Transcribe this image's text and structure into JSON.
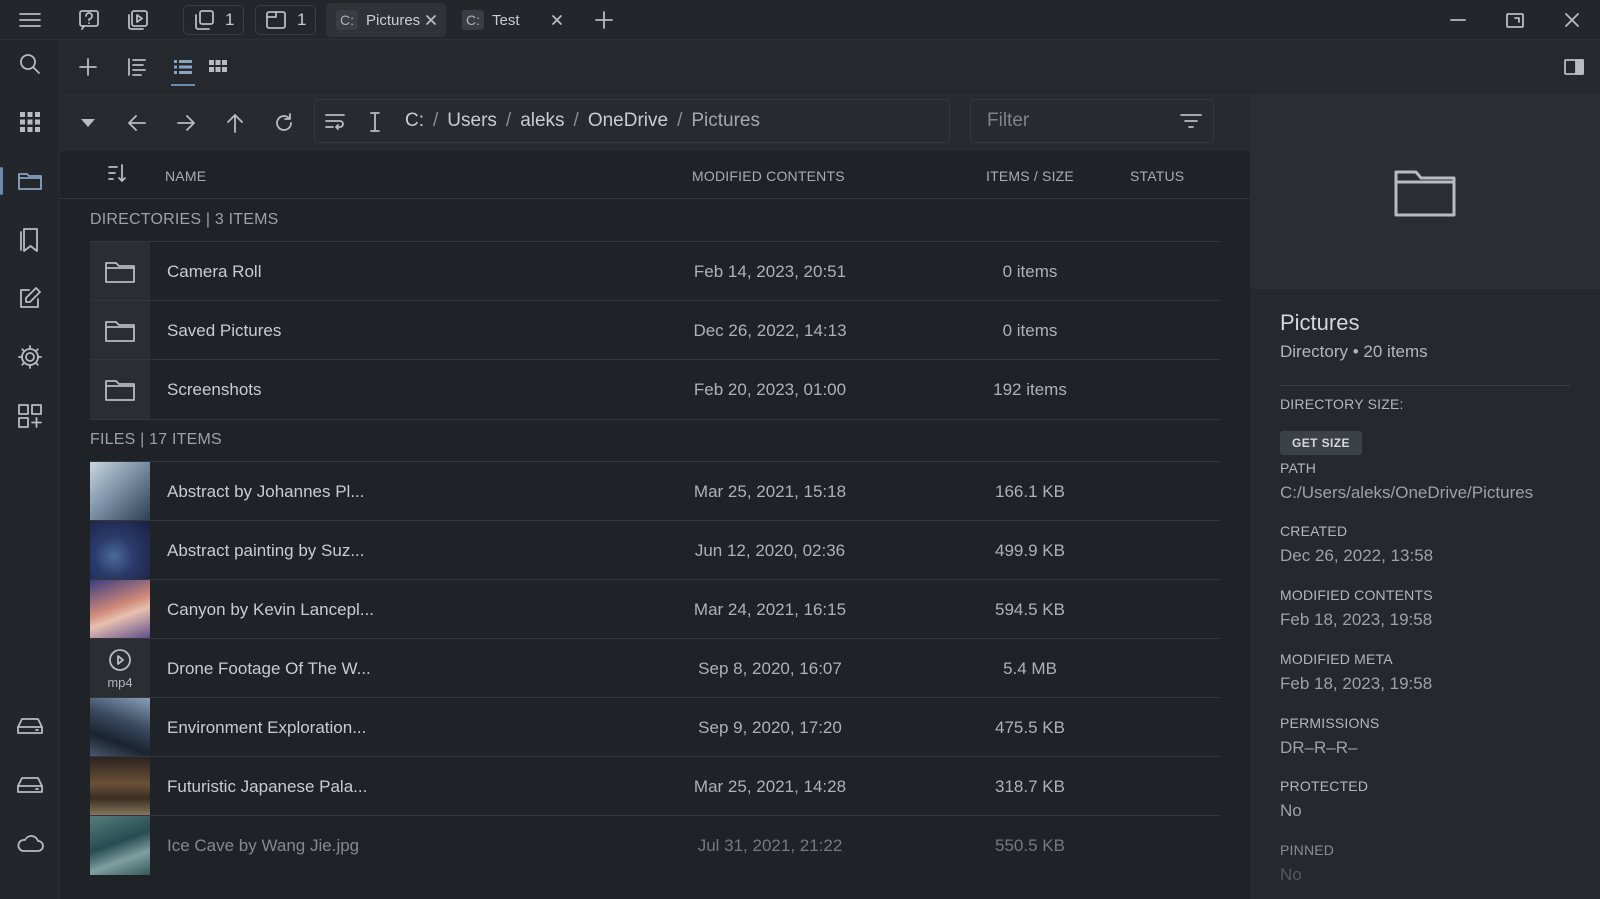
{
  "titlebar": {
    "window_count": "1",
    "pane_count": "1",
    "tabs": [
      {
        "drive": "C:",
        "label": "Pictures"
      },
      {
        "drive": "C:",
        "label": "Test"
      }
    ]
  },
  "breadcrumb": [
    "C:",
    "Users",
    "aleks",
    "OneDrive",
    "Pictures"
  ],
  "filter": {
    "placeholder": "Filter"
  },
  "columns": {
    "name": "NAME",
    "modified": "MODIFIED CONTENTS",
    "items_size": "ITEMS / SIZE",
    "status": "STATUS"
  },
  "directories": {
    "label": "DIRECTORIES | 3 ITEMS",
    "rows": [
      {
        "name": "Camera Roll",
        "date": "Feb 14, 2023, 20:51",
        "size": "0 items"
      },
      {
        "name": "Saved Pictures",
        "date": "Dec 26, 2022, 14:13",
        "size": "0 items"
      },
      {
        "name": "Screenshots",
        "date": "Feb 20, 2023, 01:00",
        "size": "192 items"
      }
    ]
  },
  "files": {
    "label": "FILES | 17 ITEMS",
    "rows": [
      {
        "name": "Abstract by Johannes Pl...",
        "date": "Mar 25, 2021, 15:18",
        "size": "166.1 KB"
      },
      {
        "name": "Abstract painting by Suz...",
        "date": "Jun 12, 2020, 02:36",
        "size": "499.9 KB"
      },
      {
        "name": "Canyon by Kevin Lancepl...",
        "date": "Mar 24, 2021, 16:15",
        "size": "594.5 KB"
      },
      {
        "name": "Drone Footage Of The W...",
        "date": "Sep 8, 2020, 16:07",
        "size": "5.4 MB",
        "ext": "mp4"
      },
      {
        "name": "Environment Exploration...",
        "date": "Sep 9, 2020, 17:20",
        "size": "475.5 KB"
      },
      {
        "name": "Futuristic Japanese Pala...",
        "date": "Mar 25, 2021, 14:28",
        "size": "318.7 KB"
      },
      {
        "name": "Ice Cave by Wang Jie.jpg",
        "date": "Jul 31, 2021, 21:22",
        "size": "550.5 KB"
      }
    ]
  },
  "details": {
    "title": "Pictures",
    "subtitle": "Directory • 20 items",
    "dir_size_label": "DIRECTORY SIZE:",
    "get_size_label": "GET SIZE",
    "path_label": "PATH",
    "path_value": "C:/Users/aleks/OneDrive/Pictures",
    "created_label": "CREATED",
    "created_value": "Dec 26, 2022, 13:58",
    "modified_contents_label": "MODIFIED CONTENTS",
    "modified_contents_value": "Feb 18, 2023, 19:58",
    "modified_meta_label": "MODIFIED META",
    "modified_meta_value": "Feb 18, 2023, 19:58",
    "permissions_label": "PERMISSIONS",
    "permissions_value": "DR–R–R–",
    "protected_label": "PROTECTED",
    "protected_value": "No",
    "pinned_label": "PINNED",
    "pinned_value": "No"
  },
  "colors": {
    "background": "#1f2226",
    "accent": "#6a8bb0"
  }
}
